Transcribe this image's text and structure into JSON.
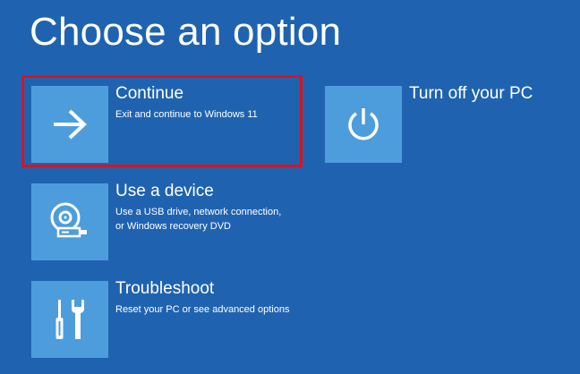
{
  "page": {
    "title": "Choose an option"
  },
  "options": {
    "continue": {
      "label": "Continue",
      "description": "Exit and continue to Windows 11",
      "icon": "arrow-right-icon"
    },
    "use_device": {
      "label": "Use a device",
      "description_lines": [
        "Use a USB drive, network connection,",
        "or Windows recovery DVD"
      ],
      "icon": "disc-drive-icon"
    },
    "troubleshoot": {
      "label": "Troubleshoot",
      "description": "Reset your PC or see advanced options",
      "icon": "tools-icon"
    },
    "turn_off": {
      "label": "Turn off your PC",
      "icon": "power-icon"
    }
  },
  "highlight": {
    "target": "continue",
    "color": "#e0101a"
  },
  "colors": {
    "background": "#1f63b0",
    "tile": "#4d9ddc",
    "text": "#ffffff"
  }
}
